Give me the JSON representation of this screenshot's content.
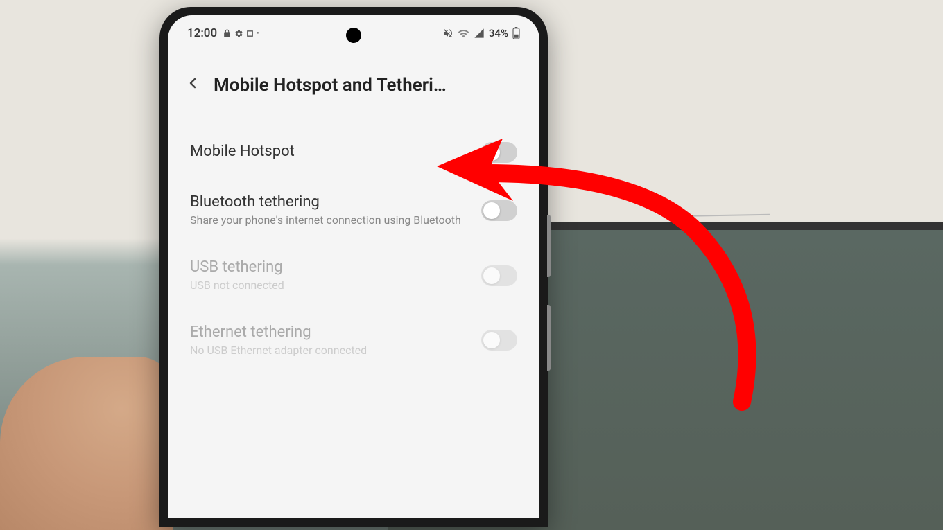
{
  "status_bar": {
    "time": "12:00",
    "battery_percent": "34%",
    "icons_left": [
      "lock-icon",
      "gear-icon",
      "square-icon",
      "dot-icon"
    ],
    "icons_right": [
      "mute-icon",
      "wifi-icon",
      "signal-icon",
      "battery-icon"
    ]
  },
  "header": {
    "title": "Mobile Hotspot and Tetheri…"
  },
  "settings": {
    "mobile_hotspot": {
      "title": "Mobile Hotspot",
      "toggle_state": "off"
    },
    "bluetooth_tethering": {
      "title": "Bluetooth tethering",
      "subtitle": "Share your phone's internet connection using Bluetooth",
      "toggle_state": "off"
    },
    "usb_tethering": {
      "title": "USB tethering",
      "subtitle": "USB not connected",
      "toggle_state": "off",
      "disabled": true
    },
    "ethernet_tethering": {
      "title": "Ethernet tethering",
      "subtitle": "No USB Ethernet adapter connected",
      "toggle_state": "off",
      "disabled": true
    }
  },
  "annotation": {
    "arrow_color": "#ff0000"
  }
}
